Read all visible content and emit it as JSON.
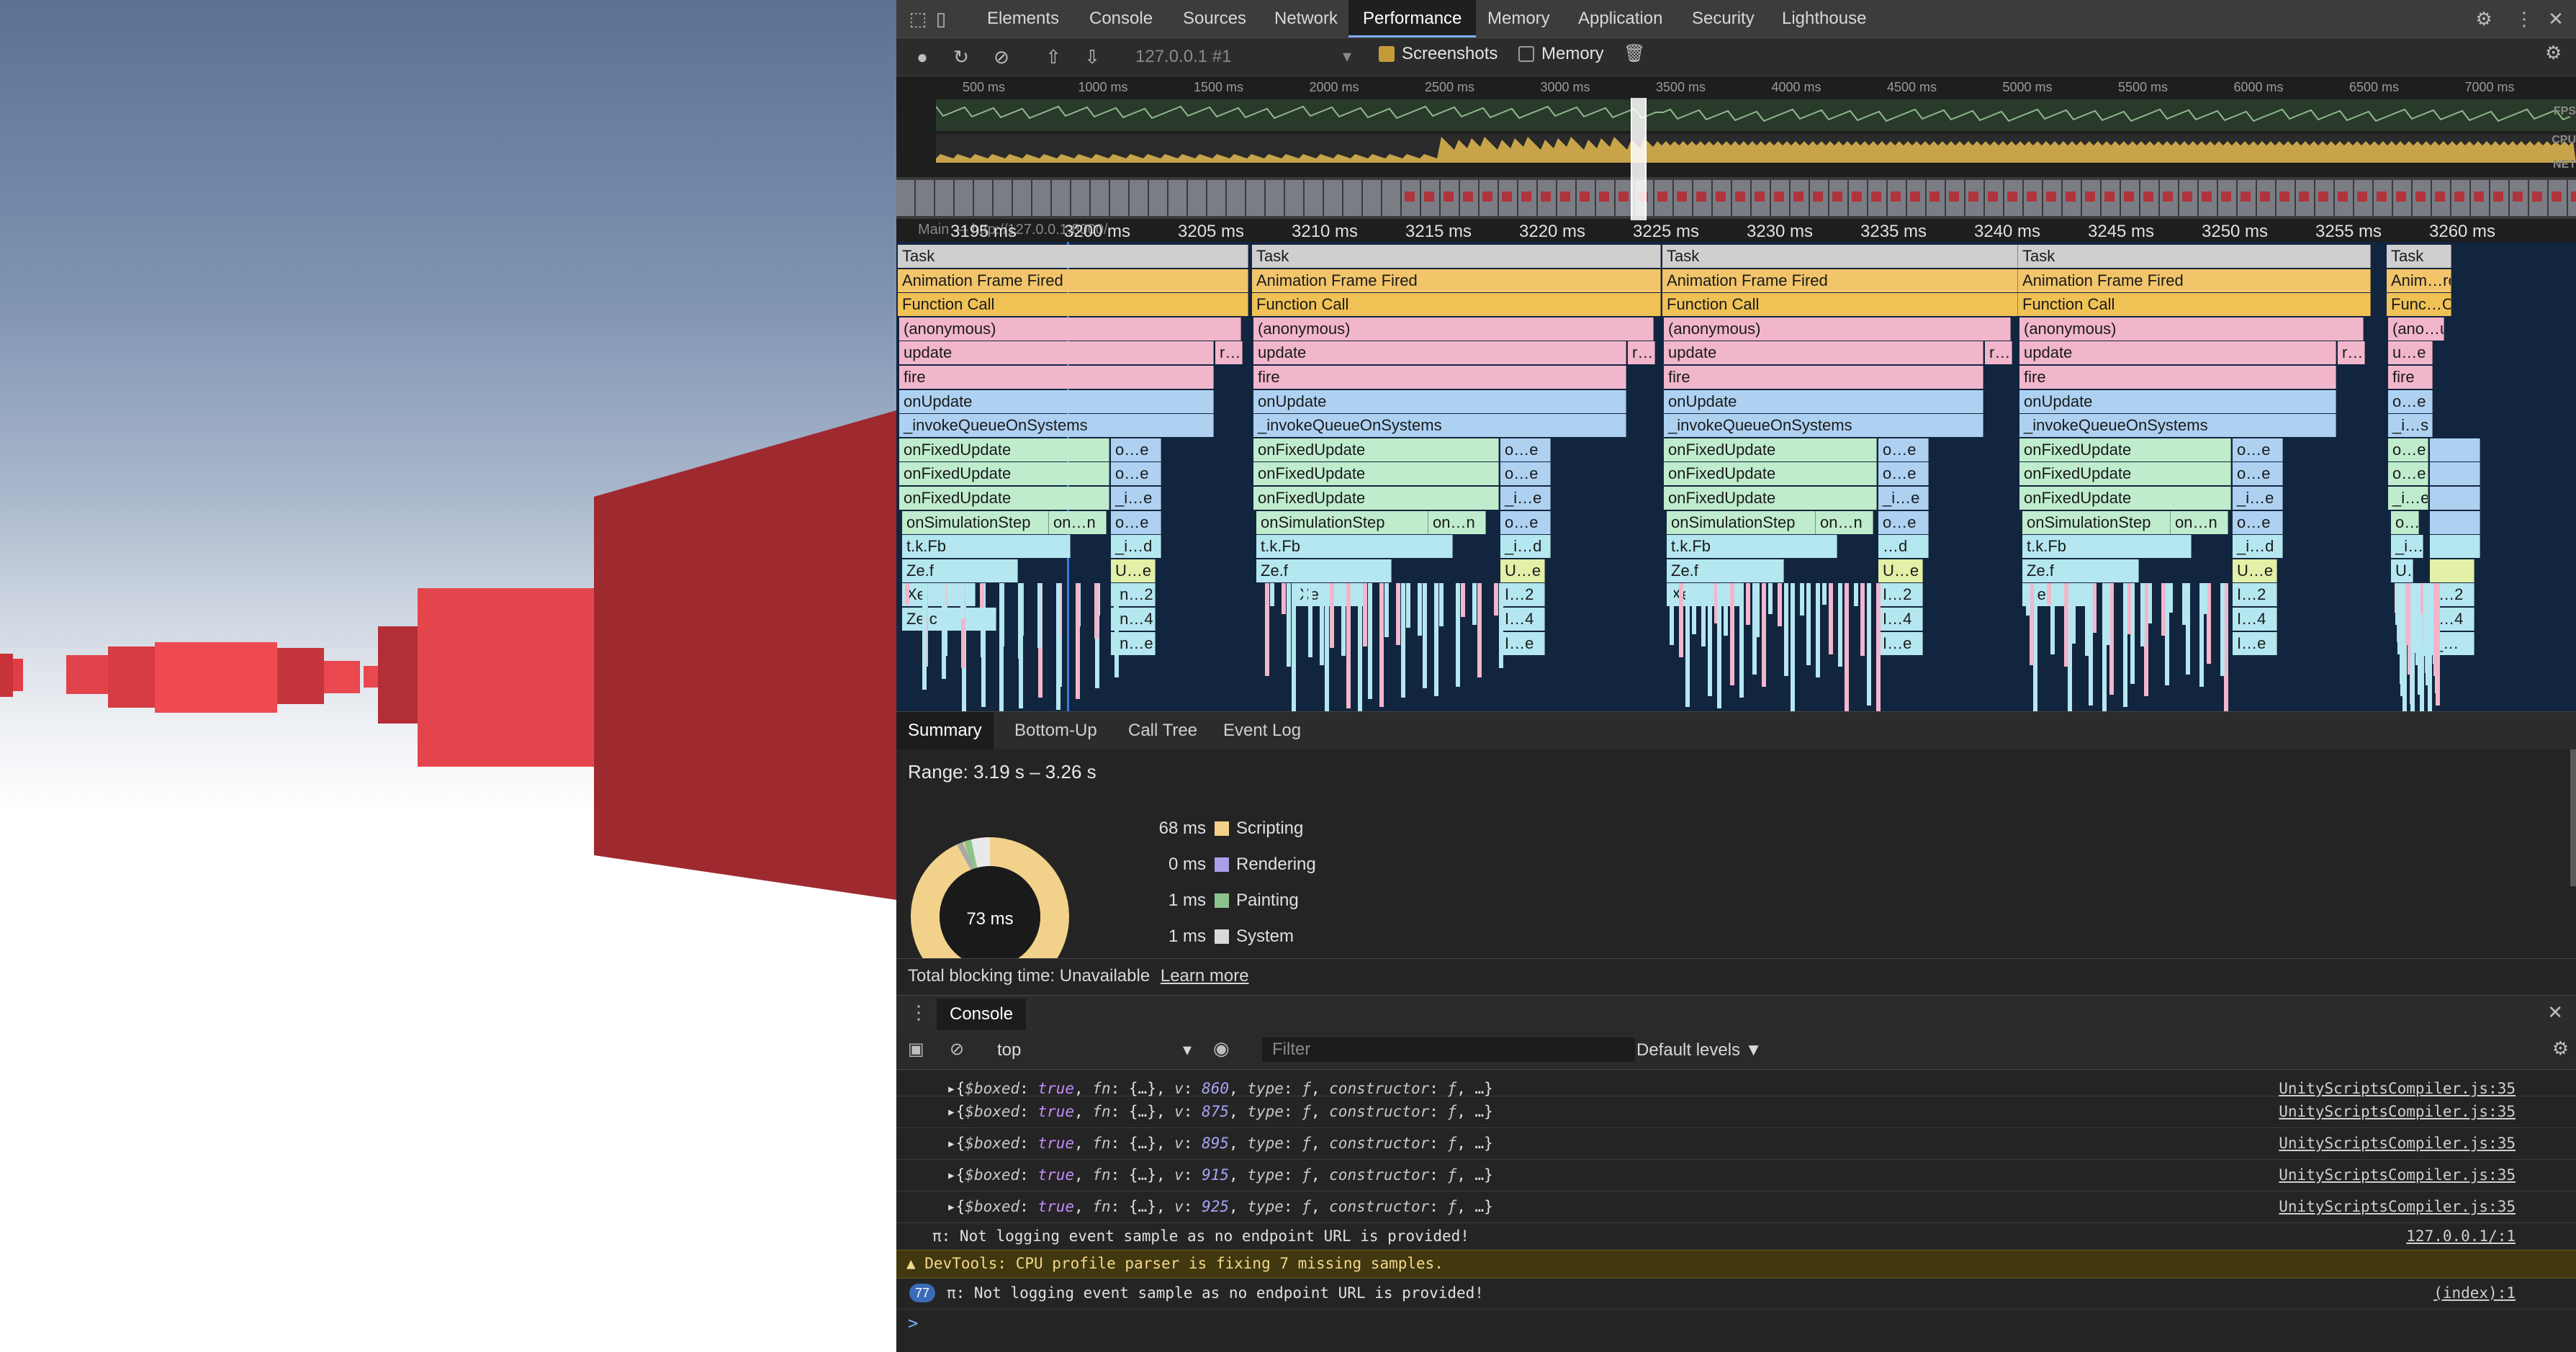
{
  "devtools": {
    "tabs": [
      "Elements",
      "Console",
      "Sources",
      "Network",
      "Performance",
      "Memory",
      "Application",
      "Security",
      "Lighthouse"
    ],
    "active_tab": "Performance",
    "icons": {
      "inspect": "inspect-element-icon",
      "device": "device-toolbar-icon",
      "settings": "gear-icon",
      "more": "more-vertical-icon",
      "close": "close-icon"
    }
  },
  "perf_toolbar": {
    "profile_select": "127.0.0.1 #1",
    "screenshots_label": "Screenshots",
    "screenshots_checked": true,
    "memory_label": "Memory",
    "memory_checked": false
  },
  "overview": {
    "ruler": [
      "500 ms",
      "1000 ms",
      "1500 ms",
      "2000 ms",
      "2500 ms",
      "3000 ms",
      "3500 ms",
      "4000 ms",
      "4500 ms",
      "5000 ms",
      "5500 ms",
      "6000 ms",
      "6500 ms",
      "7000 ms"
    ],
    "fps_label": "FPS",
    "cpu_label": "CPU",
    "net_label": "NET"
  },
  "flame": {
    "time_ticks": [
      "3195 ms",
      "3200 ms",
      "3205 ms",
      "3210 ms",
      "3215 ms",
      "3220 ms",
      "3225 ms",
      "3230 ms",
      "3235 ms",
      "3240 ms",
      "3245 ms",
      "3250 ms",
      "3255 ms",
      "3260 ms"
    ],
    "main_label": "Main — http://127.0.0.1:8000/",
    "rows": {
      "task": "Task",
      "anim": "Animation Frame Fired",
      "anim_short": "Anim…red",
      "fn": "Function Call",
      "fn_short": "Func…Call",
      "anon": "(anonymous)",
      "anon_short": "(ano…us)",
      "update": "update",
      "fire": "fire",
      "onUpdate": "onUpdate",
      "invoke": "_invokeQueueOnSystems",
      "onFixed": "onFixedUpdate",
      "onSim": "onSimulationStep",
      "tkfb": "t.k.Fb",
      "zef": "Ze.f",
      "xe": "Xe",
      "zec": "Ze.c",
      "r": "r…",
      "oe": "o…e",
      "ie": "_i…e",
      "id": "_i…d",
      "onn": "on…n",
      "ue": "U…e",
      "in2": "In…2",
      "in4": "In…4",
      "ine": "In…e",
      "i2": "I…2",
      "i4": "I…4",
      "ie2": "I…e",
      "uee": "u…e",
      "is": "_i…s",
      "d": "…d",
      "dots": "_…"
    }
  },
  "summary": {
    "tabs": [
      "Summary",
      "Bottom-Up",
      "Call Tree",
      "Event Log"
    ],
    "active": "Summary",
    "range": "Range: 3.19 s – 3.26 s",
    "total": "73 ms",
    "items": [
      {
        "value": "68 ms",
        "label": "Scripting",
        "color": "#f2d18a"
      },
      {
        "value": "0 ms",
        "label": "Rendering",
        "color": "#a99ee8"
      },
      {
        "value": "1 ms",
        "label": "Painting",
        "color": "#8bc48b"
      },
      {
        "value": "1 ms",
        "label": "System",
        "color": "#d9d9d9"
      }
    ],
    "tbt": "Total blocking time: Unavailable",
    "learn_more": "Learn more"
  },
  "console": {
    "drawer_tab": "Console",
    "context": "top",
    "filter_placeholder": "Filter",
    "levels": "Default levels ▼",
    "logs": [
      {
        "msg_pre": "▸{",
        "v": "860",
        "src": "UnityScriptsCompiler.js:35"
      },
      {
        "msg_pre": "▸{",
        "v": "875",
        "src": "UnityScriptsCompiler.js:35"
      },
      {
        "msg_pre": "▸{",
        "v": "895",
        "src": "UnityScriptsCompiler.js:35"
      },
      {
        "msg_pre": "▸{",
        "v": "915",
        "src": "UnityScriptsCompiler.js:35"
      },
      {
        "msg_pre": "▸{",
        "v": "925",
        "src": "UnityScriptsCompiler.js:35"
      }
    ],
    "log_plain": {
      "msg": "π: Not logging event sample as no endpoint URL is provided!",
      "src": "127.0.0.1/:1"
    },
    "log_warn": {
      "msg": "▲ DevTools: CPU profile parser is fixing 7 missing samples."
    },
    "log_repeat": {
      "count": "77",
      "msg": "π: Not logging event sample as no endpoint URL is provided!",
      "src": "(index):1"
    },
    "prompt": ">"
  }
}
